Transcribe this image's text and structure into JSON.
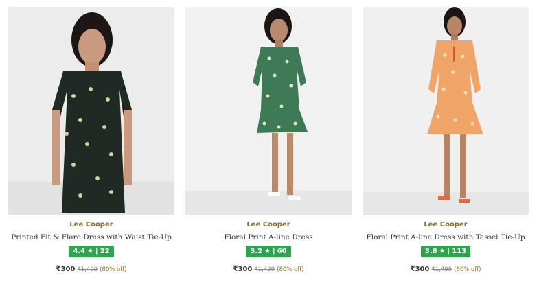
{
  "products": [
    {
      "brand": "Lee Cooper",
      "title": "Printed Fit & Flare Dress with Waist Tie-Up",
      "rating": "4.4",
      "star": "★",
      "separator": "|",
      "reviews": "22",
      "price": "₹300",
      "mrp": "₹1,499",
      "discount": "(80% off)",
      "dress_color": "#1f2a24",
      "print_color": "#d9cf9a"
    },
    {
      "brand": "Lee Cooper",
      "title": "Floral Print A-line Dress",
      "rating": "3.2",
      "star": "★",
      "separator": "|",
      "reviews": "60",
      "price": "₹300",
      "mrp": "₹1,499",
      "discount": "(80% off)",
      "dress_color": "#3f7a56",
      "print_color": "#e8e6c9"
    },
    {
      "brand": "Lee Cooper",
      "title": "Floral Print A-line Dress with Tassel Tie-Up",
      "rating": "3.8",
      "star": "★",
      "separator": "|",
      "reviews": "113",
      "price": "₹300",
      "mrp": "₹1,499",
      "discount": "(80% off)",
      "dress_color": "#f0a468",
      "print_color": "#f7e1c4"
    }
  ],
  "colors": {
    "brand": "#8a6d2b",
    "rating_badge": "#2ea44f",
    "image_background": "#efefef"
  }
}
